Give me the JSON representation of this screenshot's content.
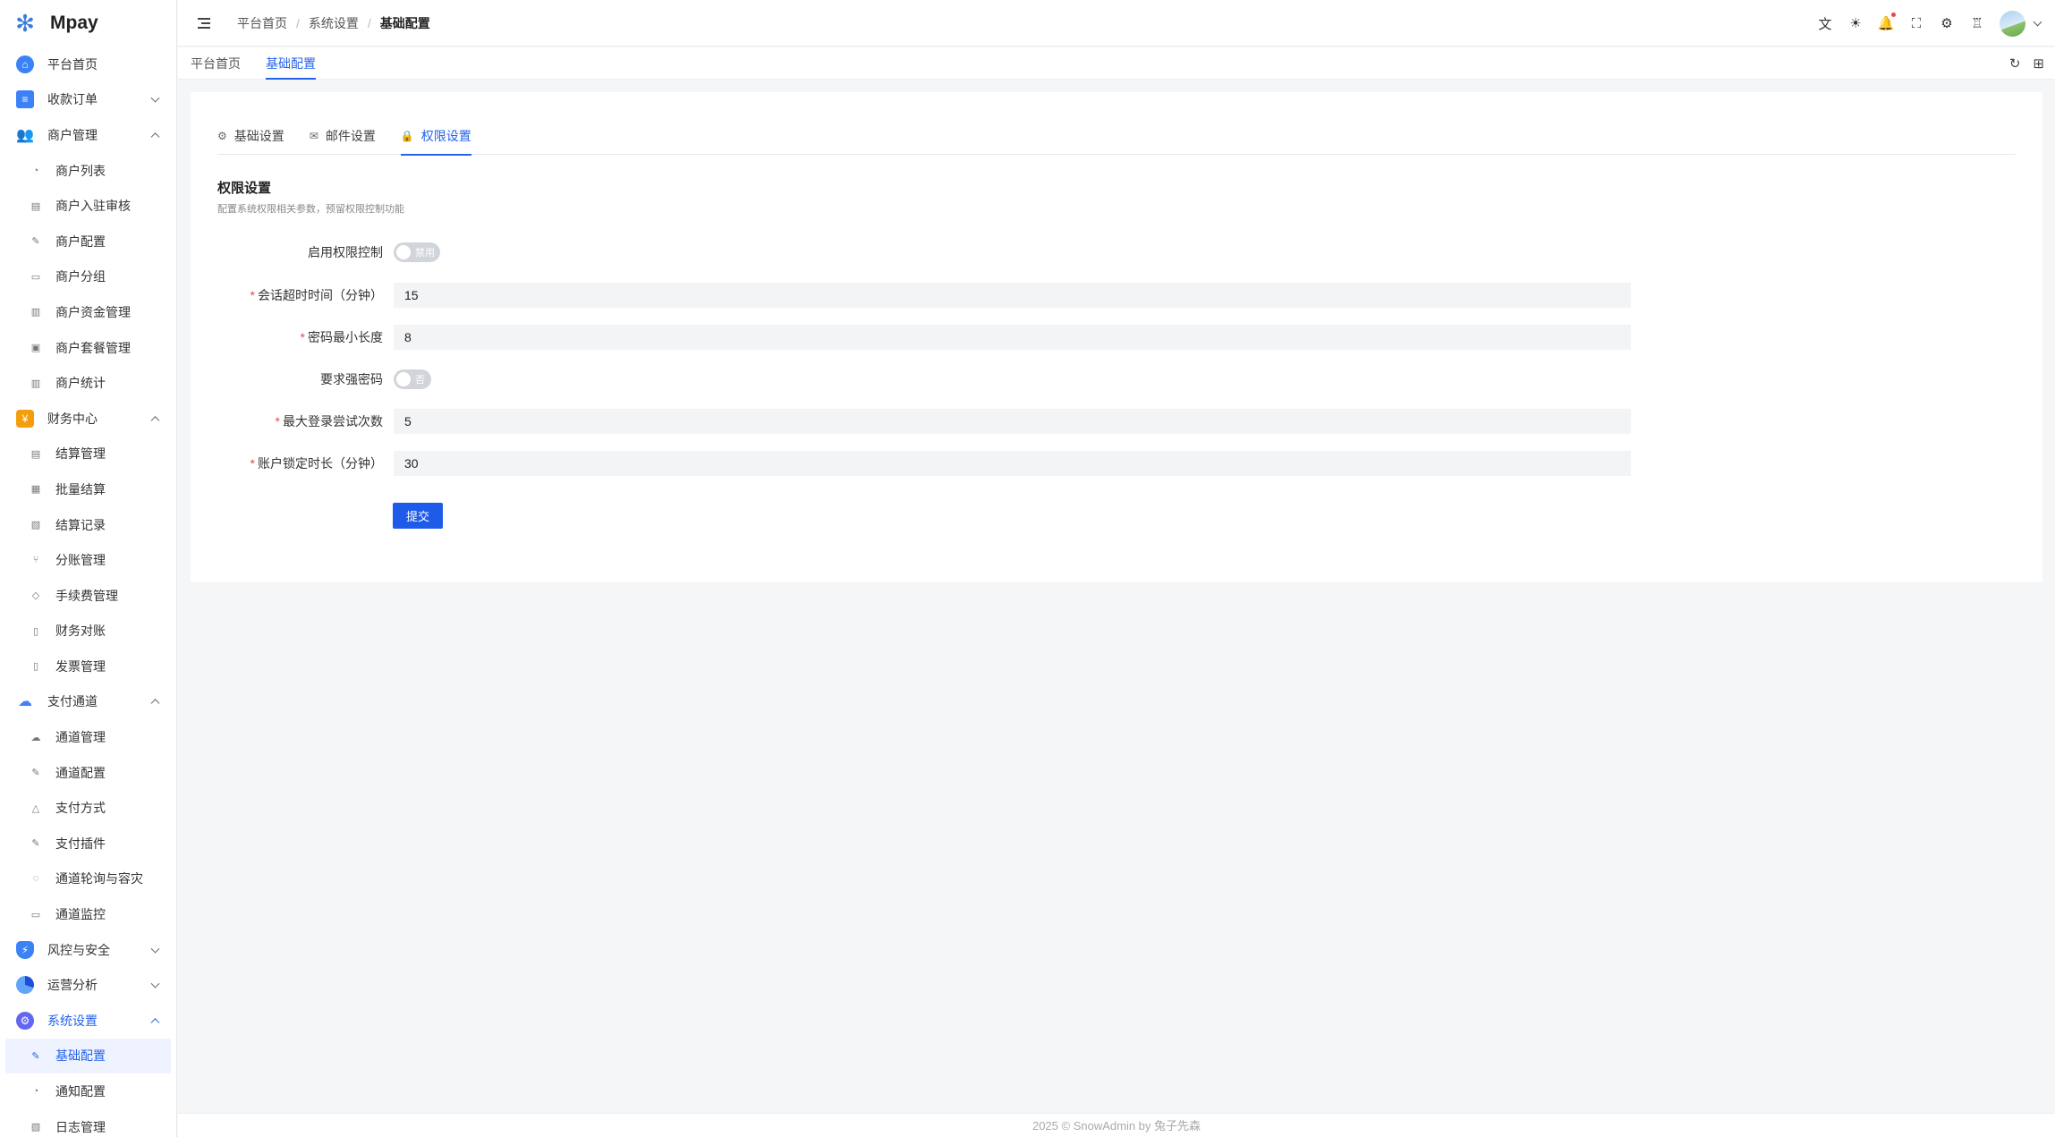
{
  "app": {
    "name": "Mpay"
  },
  "sidebar": {
    "items": [
      {
        "label": "平台首页",
        "icon": "home-icon",
        "color": "#3b82f6"
      },
      {
        "label": "收款订单",
        "icon": "document-icon",
        "color": "#3b82f6",
        "expand": "down"
      },
      {
        "label": "商户管理",
        "icon": "users-icon",
        "color": "#3b82f6",
        "expand": "up"
      }
    ],
    "merchant_sub": [
      "商户列表",
      "商户入驻审核",
      "商户配置",
      "商户分组",
      "商户资金管理",
      "商户套餐管理",
      "商户统计"
    ],
    "finance": {
      "label": "财务中心",
      "icon": "wallet-icon",
      "color": "#f59e0b"
    },
    "finance_sub": [
      "结算管理",
      "批量结算",
      "结算记录",
      "分账管理",
      "手续费管理",
      "财务对账",
      "发票管理"
    ],
    "channel": {
      "label": "支付通道",
      "icon": "channel-icon",
      "color": "#3b82f6"
    },
    "channel_sub": [
      "通道管理",
      "通道配置",
      "支付方式",
      "支付插件",
      "通道轮询与容灾",
      "通道监控"
    ],
    "risk": {
      "label": "风控与安全",
      "icon": "shield-icon",
      "color": "#3b82f6"
    },
    "ops": {
      "label": "运营分析",
      "icon": "pie-chart-icon",
      "color": "#3b82f6"
    },
    "system": {
      "label": "系统设置",
      "icon": "settings-icon",
      "color": "#6366f1"
    },
    "system_sub": [
      "基础配置",
      "通知配置",
      "日志管理"
    ]
  },
  "header": {
    "breadcrumb": [
      "平台首页",
      "系统设置",
      "基础配置"
    ],
    "icons": [
      "translate-icon",
      "sun-icon",
      "bell-icon",
      "fullscreen-icon",
      "gear-icon",
      "shirt-icon"
    ]
  },
  "page_tabs": [
    "平台首页",
    "基础配置"
  ],
  "form_tabs": [
    {
      "label": "基础设置",
      "icon": "gear-icon"
    },
    {
      "label": "邮件设置",
      "icon": "mail-icon"
    },
    {
      "label": "权限设置",
      "icon": "lock-icon"
    }
  ],
  "section": {
    "title": "权限设置",
    "desc": "配置系统权限相关参数，预留权限控制功能"
  },
  "form": {
    "enable_label": "启用权限控制",
    "enable_switch": "禁用",
    "session_label": "会话超时时间（分钟）",
    "session_value": "15",
    "pwd_len_label": "密码最小长度",
    "pwd_len_value": "8",
    "strong_label": "要求强密码",
    "strong_switch": "否",
    "max_login_label": "最大登录尝试次数",
    "max_login_value": "5",
    "lock_label": "账户锁定时长（分钟）",
    "lock_value": "30",
    "submit": "提交"
  },
  "footer": "2025 © SnowAdmin by 兔子先森",
  "colors": {
    "accent": "#2563eb",
    "required": "#ef4444"
  }
}
